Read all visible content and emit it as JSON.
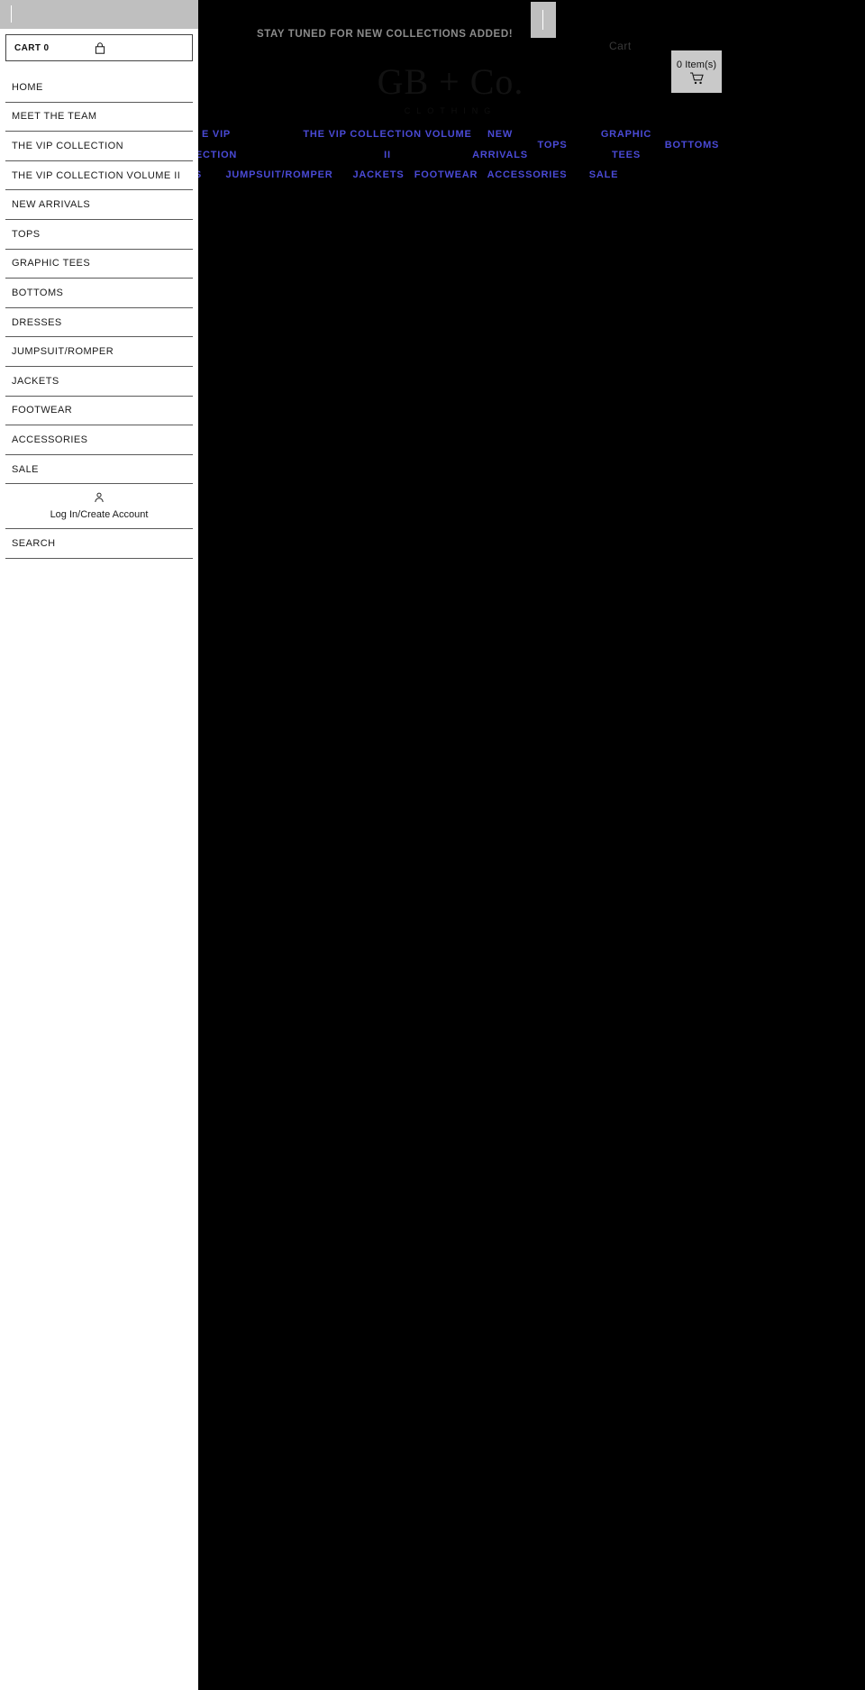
{
  "announcement": "STAY TUNED FOR NEW COLLECTIONS ADDED!",
  "brand": {
    "name": "GB + Co.",
    "tagline": "CLOTHING"
  },
  "cart": {
    "word": "Cart",
    "items_label": "0 Item(s)",
    "icon": "shopping-cart-icon",
    "sidebar_label": "CART 0",
    "sidebar_icon": "shopping-bag-icon"
  },
  "blue_nav": [
    {
      "label": "E VIP\nECTION"
    },
    {
      "label": "THE VIP COLLECTION VOLUME II"
    },
    {
      "label": "NEW ARRIVALS"
    },
    {
      "label": "TOPS"
    },
    {
      "label": "GRAPHIC TEES"
    },
    {
      "label": "BOTTOMS"
    },
    {
      "label": "S"
    },
    {
      "label": "JUMPSUIT/ROMPER"
    },
    {
      "label": "JACKETS"
    },
    {
      "label": "FOOTWEAR"
    },
    {
      "label": "ACCESSORIES"
    },
    {
      "label": "SALE"
    }
  ],
  "blue_nav_rows": {
    "r1_c1_top": "E VIP",
    "r1_c1_bot": "ECTION",
    "r1_c2_top": "THE VIP COLLECTION VOLUME",
    "r1_c2_bot": "II",
    "r1_c3_top": "NEW",
    "r1_c3_bot": "ARRIVALS",
    "r1_c4": "TOPS",
    "r1_c5_top": "GRAPHIC",
    "r1_c5_bot": "TEES",
    "r1_c6": "BOTTOMS",
    "r2_c1": "S",
    "r2_c2": "JUMPSUIT/ROMPER",
    "r2_c3": "JACKETS",
    "r2_c4": "FOOTWEAR",
    "r2_c5": "ACCESSORIES",
    "r2_c6": "SALE"
  },
  "sidebar": {
    "items": [
      {
        "label": "HOME"
      },
      {
        "label": "MEET THE TEAM"
      },
      {
        "label": "THE VIP COLLECTION"
      },
      {
        "label": "THE VIP COLLECTION VOLUME II"
      },
      {
        "label": "NEW ARRIVALS"
      },
      {
        "label": "TOPS"
      },
      {
        "label": "GRAPHIC TEES"
      },
      {
        "label": "BOTTOMS"
      },
      {
        "label": "DRESSES"
      },
      {
        "label": "JUMPSUIT/ROMPER"
      },
      {
        "label": "JACKETS"
      },
      {
        "label": "FOOTWEAR"
      },
      {
        "label": "ACCESSORIES"
      },
      {
        "label": "SALE"
      }
    ],
    "account": {
      "label": "Log In/Create Account",
      "icon": "person-icon"
    },
    "search": {
      "label": "SEARCH",
      "icon": "search-icon"
    }
  },
  "colors": {
    "background": "#000000",
    "sidebar_bg": "#ffffff",
    "nav_link": "#4a4ad6",
    "announce_text": "#8c8c8c",
    "grey_ui": "#bfbfbf"
  }
}
